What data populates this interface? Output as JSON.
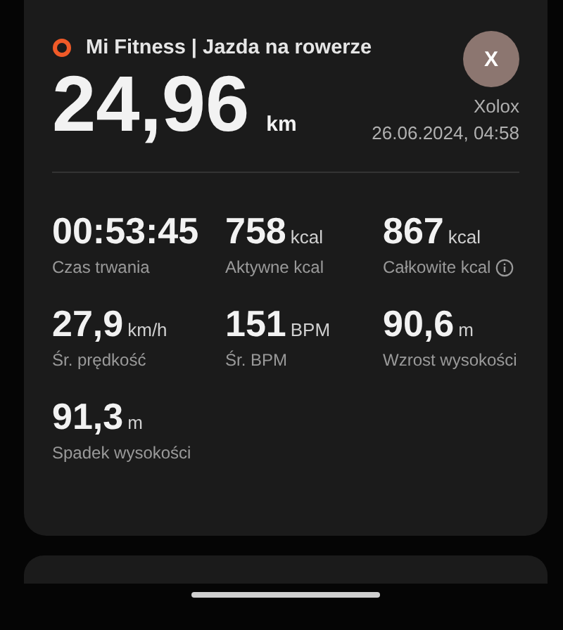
{
  "card": {
    "app_title": "Mi Fitness | Jazda na rowerze",
    "avatar_letter": "X",
    "distance": {
      "value": "24,96",
      "unit": "km"
    },
    "user_name": "Xolox",
    "date": "26.06.2024, 04:58",
    "stats": [
      {
        "value": "00:53:45",
        "label": "Czas trwania",
        "info": false
      },
      {
        "value": "758",
        "unit": "kcal",
        "label": "Aktywne kcal",
        "info": false
      },
      {
        "value": "867",
        "unit": "kcal",
        "label": "Całkowite kcal",
        "info": true
      },
      {
        "value": "27,9",
        "unit": "km/h",
        "label": "Śr. prędkość",
        "info": false
      },
      {
        "value": "151",
        "unit": "BPM",
        "label": "Śr. BPM",
        "info": false
      },
      {
        "value": "90,6",
        "unit": "m",
        "label": "Wzrost wysokości",
        "info": false
      },
      {
        "value": "91,3",
        "unit": "m",
        "label": "Spadek wysokości",
        "info": false
      }
    ]
  }
}
